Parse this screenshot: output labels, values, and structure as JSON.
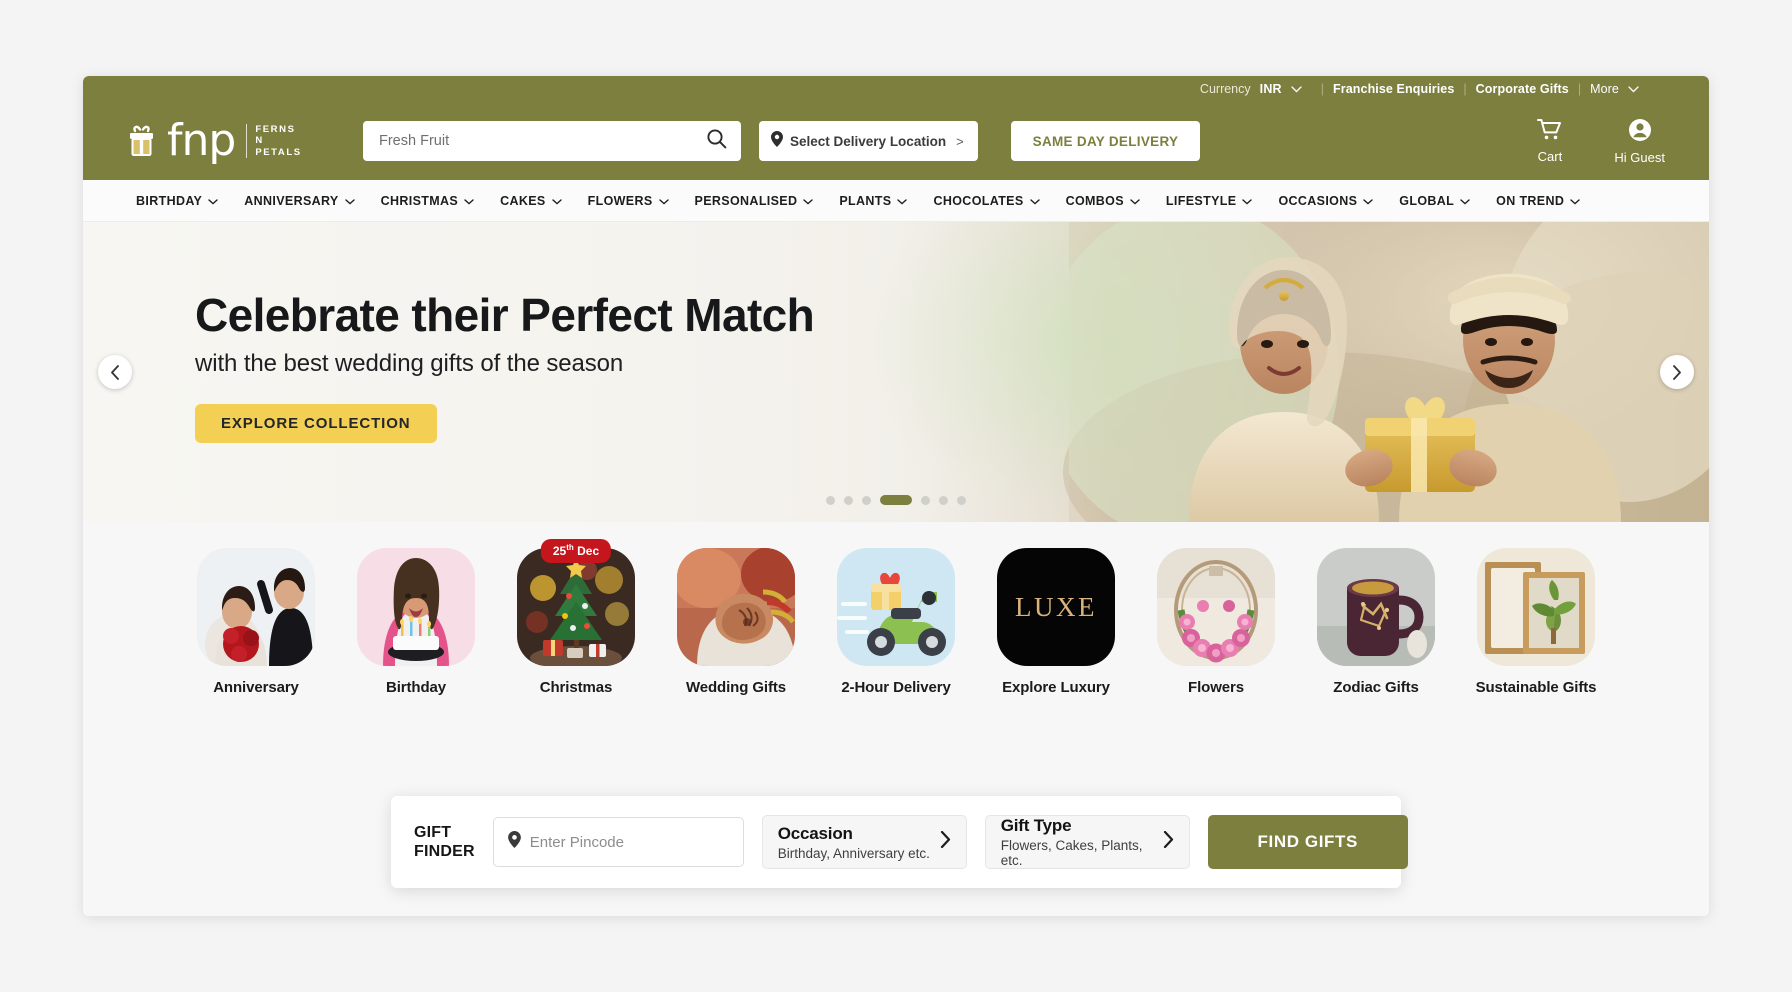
{
  "topbar": {
    "currency_label": "Currency",
    "currency_value": "INR",
    "franchise": "Franchise Enquiries",
    "corporate": "Corporate Gifts",
    "more": "More",
    "separator": "|"
  },
  "header": {
    "logo_word": "fnp",
    "logo_sub_line1": "FERNS",
    "logo_sub_line2": "N",
    "logo_sub_line3": "PETALS",
    "search_placeholder": "Fresh Fruit",
    "search_value": "",
    "location_text": "Select Delivery Location",
    "location_arrow": ">",
    "same_day_delivery": "SAME DAY DELIVERY",
    "cart_label": "Cart",
    "account_label": "Hi Guest"
  },
  "nav": {
    "items": [
      {
        "label": "BIRTHDAY"
      },
      {
        "label": "ANNIVERSARY"
      },
      {
        "label": "CHRISTMAS"
      },
      {
        "label": "CAKES"
      },
      {
        "label": "FLOWERS"
      },
      {
        "label": "PERSONALISED"
      },
      {
        "label": "PLANTS"
      },
      {
        "label": "CHOCOLATES"
      },
      {
        "label": "COMBOS"
      },
      {
        "label": "LIFESTYLE"
      },
      {
        "label": "OCCASIONS"
      },
      {
        "label": "GLOBAL"
      },
      {
        "label": "ON TREND"
      }
    ]
  },
  "hero": {
    "title": "Celebrate their Perfect Match",
    "subtitle": "with the best wedding gifts of the season",
    "cta_label": "EXPLORE COLLECTION",
    "dots_total": 7,
    "dots_active_index": 3,
    "accent_color": "#f3cf53"
  },
  "categories": [
    {
      "label": "Anniversary",
      "badge": null
    },
    {
      "label": "Birthday",
      "badge": null
    },
    {
      "label": "Christmas",
      "badge_num": "25",
      "badge_sup": "th",
      "badge_rest": " Dec"
    },
    {
      "label": "Wedding Gifts",
      "badge": null
    },
    {
      "label": "2-Hour Delivery",
      "badge": null
    },
    {
      "label": "Explore Luxury",
      "badge": null,
      "tile_text": "LUXE"
    },
    {
      "label": "Flowers",
      "badge": null
    },
    {
      "label": "Zodiac Gifts",
      "badge": null
    },
    {
      "label": "Sustainable Gifts",
      "badge": null
    }
  ],
  "gift_finder": {
    "title_line1": "GIFT",
    "title_line2": "FINDER",
    "pincode_placeholder": "Enter Pincode",
    "pincode_value": "",
    "occasion_label": "Occasion",
    "occasion_sub": "Birthday, Anniversary etc.",
    "gift_type_label": "Gift Type",
    "gift_type_sub": "Flowers, Cakes, Plants, etc.",
    "chevron": "›",
    "find_button": "FIND GIFTS"
  },
  "theme": {
    "brand_olive": "#7c7f3d",
    "badge_red": "#c4161c",
    "cta_yellow": "#f3cf53",
    "luxe_gold": "#d9b27c"
  }
}
